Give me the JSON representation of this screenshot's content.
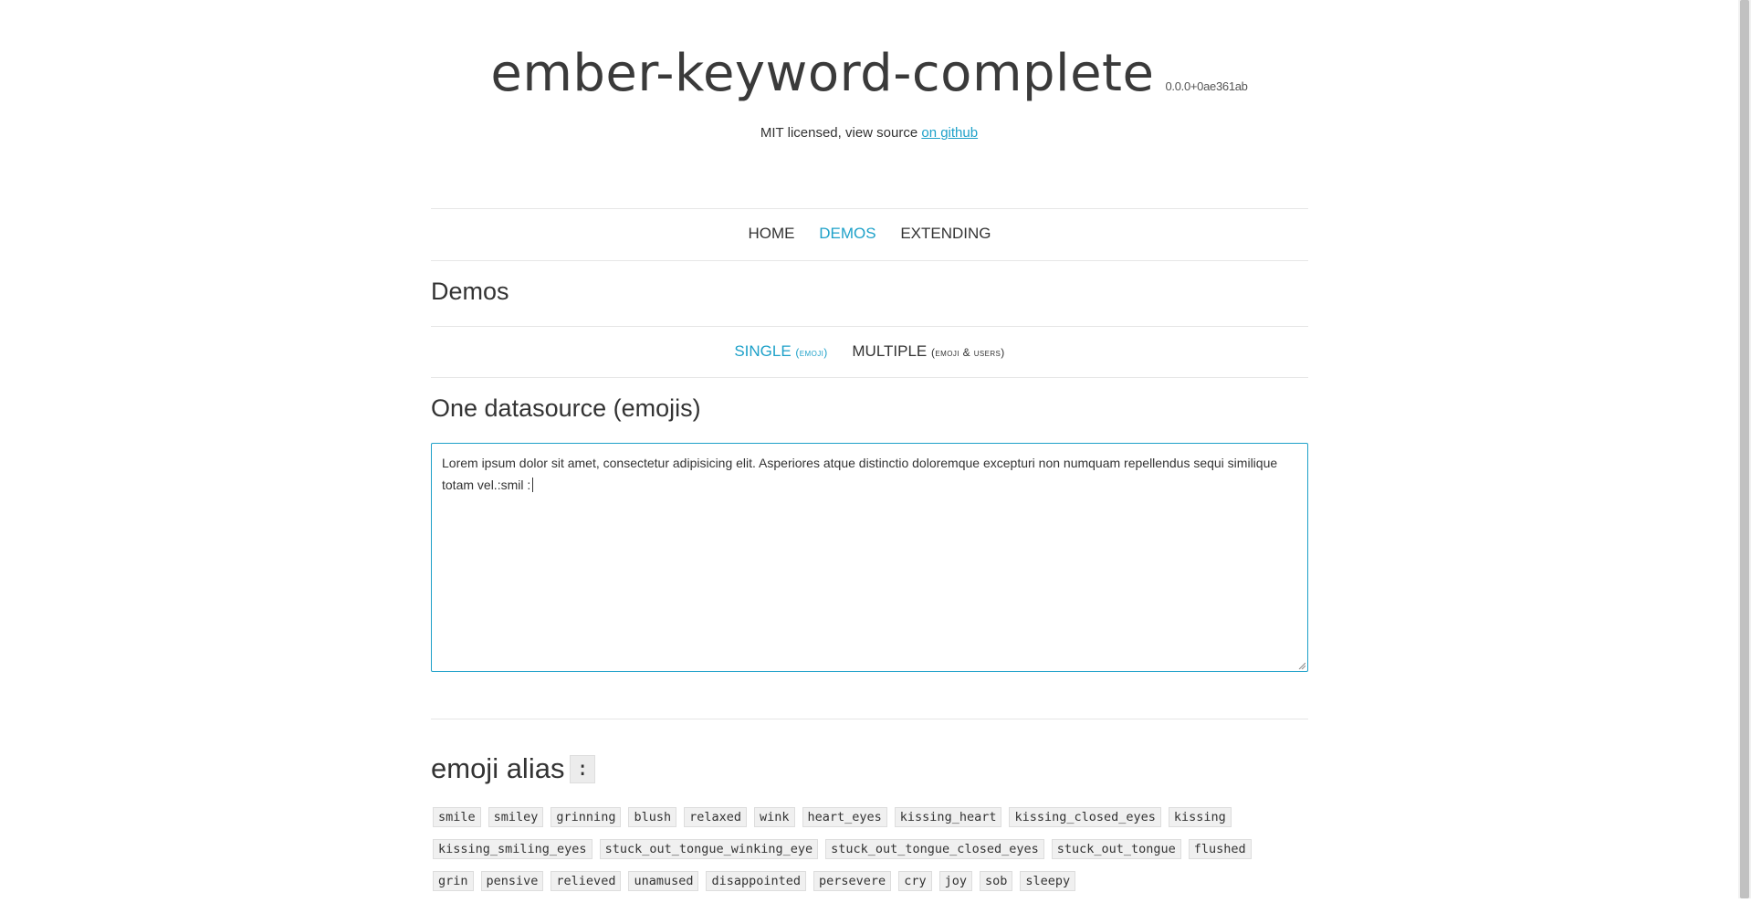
{
  "header": {
    "title": "ember-keyword-complete",
    "version": "0.0.0+0ae361ab",
    "license_prefix": "MIT licensed, view source ",
    "license_link": "on github"
  },
  "nav": {
    "items": [
      {
        "label": "HOME",
        "active": false
      },
      {
        "label": "DEMOS",
        "active": true
      },
      {
        "label": "EXTENDING",
        "active": false
      }
    ]
  },
  "demos": {
    "heading": "Demos",
    "tabs": [
      {
        "label": "SINGLE",
        "sub": "(EMOJI)",
        "active": true
      },
      {
        "label": "MULTIPLE",
        "sub": "(EMOJI & USERS)",
        "active": false
      }
    ]
  },
  "section": {
    "heading": "One datasource (emojis)",
    "textarea_value": "Lorem ipsum dolor sit amet, consectetur adipisicing elit. Asperiores atque distinctio doloremque excepturi non numquam repellendus sequi similique totam vel.:smil :"
  },
  "alias": {
    "heading": "emoji alias",
    "trigger": ":",
    "rows": [
      [
        "smile",
        "smiley",
        "grinning",
        "blush",
        "relaxed",
        "wink",
        "heart_eyes",
        "kissing_heart",
        "kissing_closed_eyes",
        "kissing"
      ],
      [
        "kissing_smiling_eyes",
        "stuck_out_tongue_winking_eye",
        "stuck_out_tongue_closed_eyes",
        "stuck_out_tongue",
        "flushed"
      ],
      [
        "grin",
        "pensive",
        "relieved",
        "unamused",
        "disappointed",
        "persevere",
        "cry",
        "joy",
        "sob",
        "sleepy"
      ]
    ]
  },
  "colors": {
    "accent": "#1ea1c9",
    "text": "#333333",
    "tag_bg": "#f0f0f0"
  }
}
